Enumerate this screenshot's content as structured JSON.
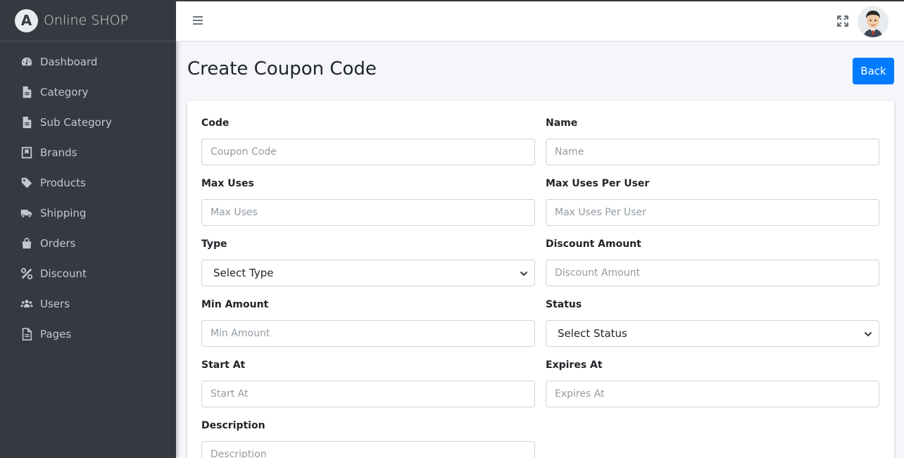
{
  "app": {
    "brand_logo_letter": "A",
    "brand_name": "Online SHOP"
  },
  "sidebar": {
    "items": [
      {
        "label": "Dashboard",
        "icon": "tachometer-icon"
      },
      {
        "label": "Category",
        "icon": "file-icon"
      },
      {
        "label": "Sub Category",
        "icon": "file-icon"
      },
      {
        "label": "Brands",
        "icon": "book-icon"
      },
      {
        "label": "Products",
        "icon": "tag-icon"
      },
      {
        "label": "Shipping",
        "icon": "truck-icon"
      },
      {
        "label": "Orders",
        "icon": "shopping-bag-icon"
      },
      {
        "label": "Discount",
        "icon": "percent-icon"
      },
      {
        "label": "Users",
        "icon": "users-icon"
      },
      {
        "label": "Pages",
        "icon": "file-alt-icon"
      }
    ]
  },
  "topbar": {
    "menu_icon": "hamburger-icon",
    "fullscreen_icon": "expand-icon",
    "avatar_icon": "user-avatar"
  },
  "page": {
    "title": "Create Coupon Code",
    "back_label": "Back"
  },
  "form": {
    "code": {
      "label": "Code",
      "placeholder": "Coupon Code"
    },
    "name": {
      "label": "Name",
      "placeholder": "Name"
    },
    "max_uses": {
      "label": "Max Uses",
      "placeholder": "Max Uses"
    },
    "max_uses_user": {
      "label": "Max Uses Per User",
      "placeholder": "Max Uses Per User"
    },
    "type": {
      "label": "Type",
      "value": "Select Type"
    },
    "discount_amount": {
      "label": "Discount Amount",
      "placeholder": "Discount Amount"
    },
    "min_amount": {
      "label": "Min Amount",
      "placeholder": "Min Amount"
    },
    "status": {
      "label": "Status",
      "value": "Select Status"
    },
    "start_at": {
      "label": "Start At",
      "placeholder": "Start At"
    },
    "expires_at": {
      "label": "Expires At",
      "placeholder": "Expires At"
    },
    "description": {
      "label": "Description",
      "placeholder": "Description"
    }
  },
  "colors": {
    "sidebar_bg": "#343a40",
    "primary": "#007bff",
    "content_bg": "#f4f6f9"
  }
}
